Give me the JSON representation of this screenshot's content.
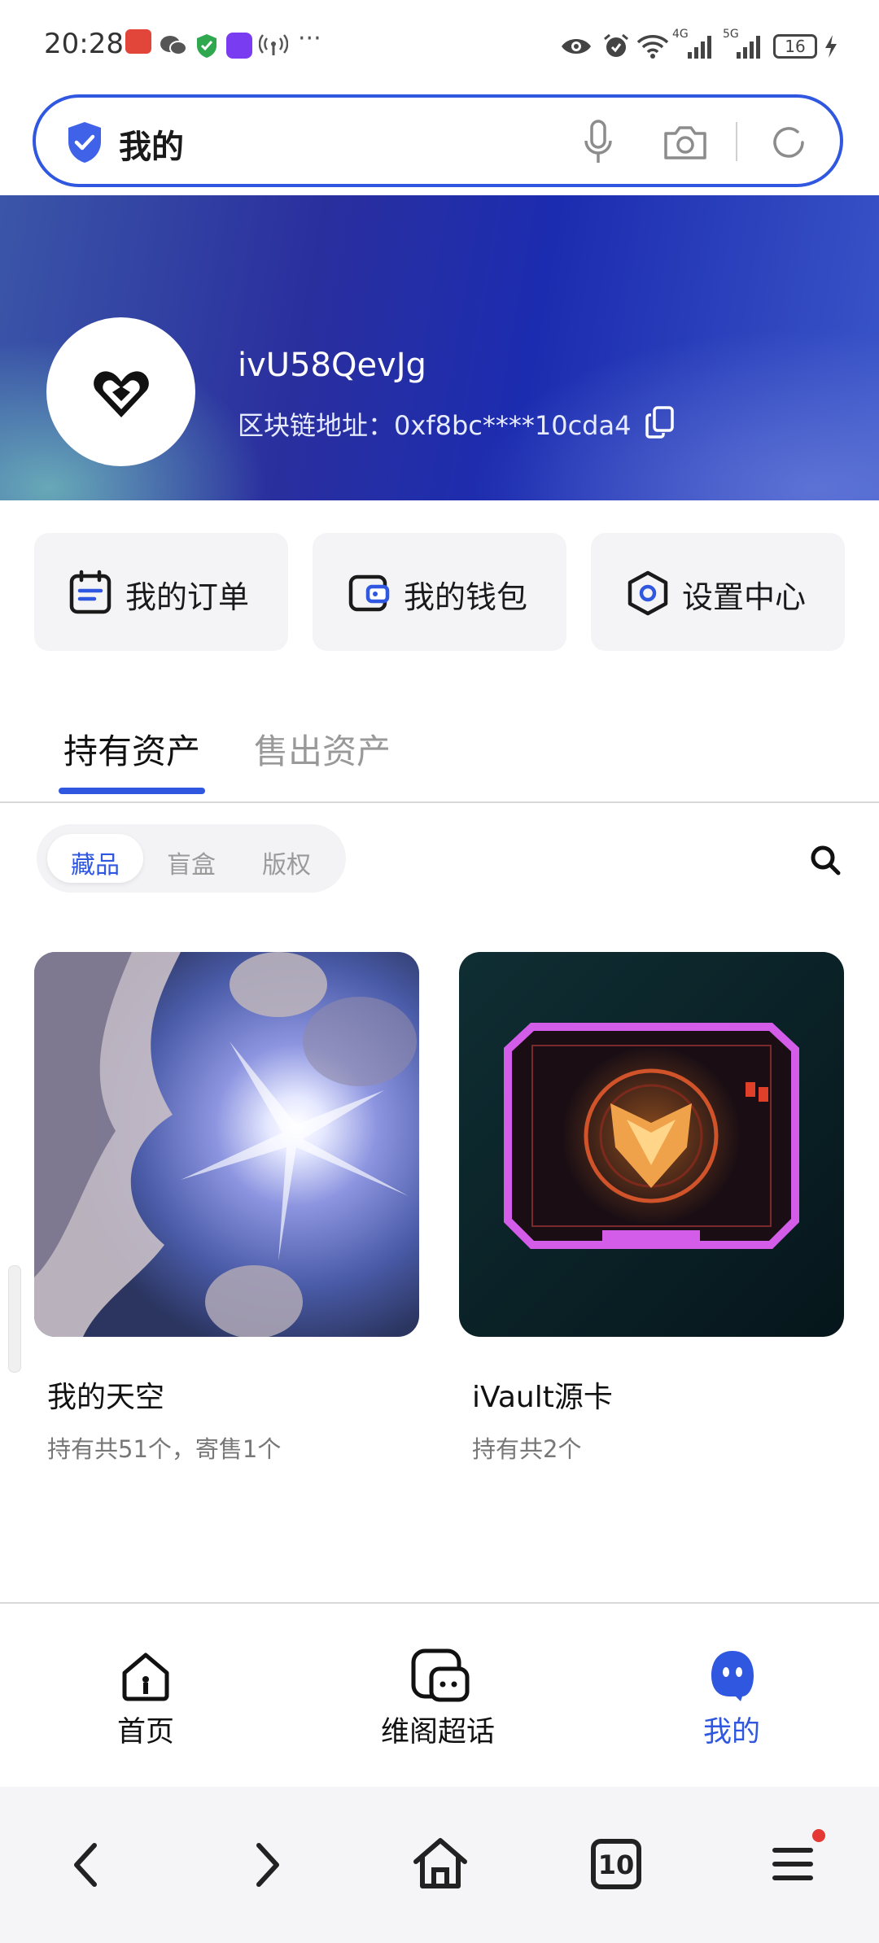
{
  "status_bar": {
    "time": "20:28",
    "battery": "16",
    "network_1": "4G",
    "network_2": "5G"
  },
  "search_bar": {
    "title": "我的",
    "icons": [
      "shield-check-icon",
      "microphone-icon",
      "camera-icon",
      "refresh-icon"
    ]
  },
  "profile": {
    "username": "ivU58QevJg",
    "chain_address_label": "区块链地址：",
    "chain_address": "0xf8bc****10cda4"
  },
  "quick_actions": [
    {
      "label": "我的订单",
      "icon": "order-icon"
    },
    {
      "label": "我的钱包",
      "icon": "wallet-icon"
    },
    {
      "label": "设置中心",
      "icon": "settings-icon"
    }
  ],
  "tabs": [
    {
      "label": "持有资产",
      "active": true
    },
    {
      "label": "售出资产",
      "active": false
    }
  ],
  "segments": [
    {
      "label": "藏品",
      "active": true
    },
    {
      "label": "盲盒",
      "active": false
    },
    {
      "label": "版权",
      "active": false
    }
  ],
  "assets": [
    {
      "title": "我的天空",
      "subtitle": "持有共51个，寄售1个"
    },
    {
      "title": "iVault源卡",
      "subtitle": "持有共2个"
    }
  ],
  "bottom_nav": [
    {
      "label": "首页",
      "icon": "home-icon",
      "active": false
    },
    {
      "label": "维阁超话",
      "icon": "chat-icon",
      "active": false
    },
    {
      "label": "我的",
      "icon": "profile-icon",
      "active": true
    }
  ],
  "browser_bar": {
    "tabs_count": "10"
  },
  "colors": {
    "accent": "#2f57e0",
    "notification_dot": "#e53935"
  }
}
